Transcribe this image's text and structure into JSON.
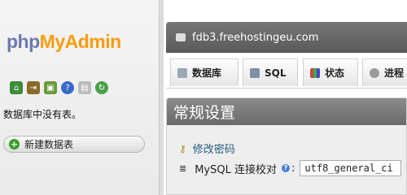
{
  "logo": {
    "php": "php",
    "myadmin": "MyAdmin"
  },
  "sidebar": {
    "nav_icons": [
      "home-icon",
      "exit-icon",
      "query-window-icon",
      "help-icon",
      "docs-icon",
      "reload-icon"
    ],
    "no_tables_text": "数据库中没有表。",
    "new_db_label": "新建数据表"
  },
  "server": {
    "name": "fdb3.freehostingeu.com"
  },
  "tabs": [
    {
      "label": "数据库",
      "icon": "database-icon"
    },
    {
      "label": "SQL",
      "icon": "sql-icon"
    },
    {
      "label": "状态",
      "icon": "status-icon"
    },
    {
      "label": "进程",
      "icon": "gear-icon"
    }
  ],
  "general_settings": {
    "title": "常规设置",
    "change_password_label": "修改密码",
    "collation_label": "MySQL 连接校对",
    "collation_value": "utf8_general_ci"
  },
  "colors": {
    "logo_php": "#6c78af",
    "logo_myadmin": "#f89c0e",
    "link": "#235a81"
  }
}
